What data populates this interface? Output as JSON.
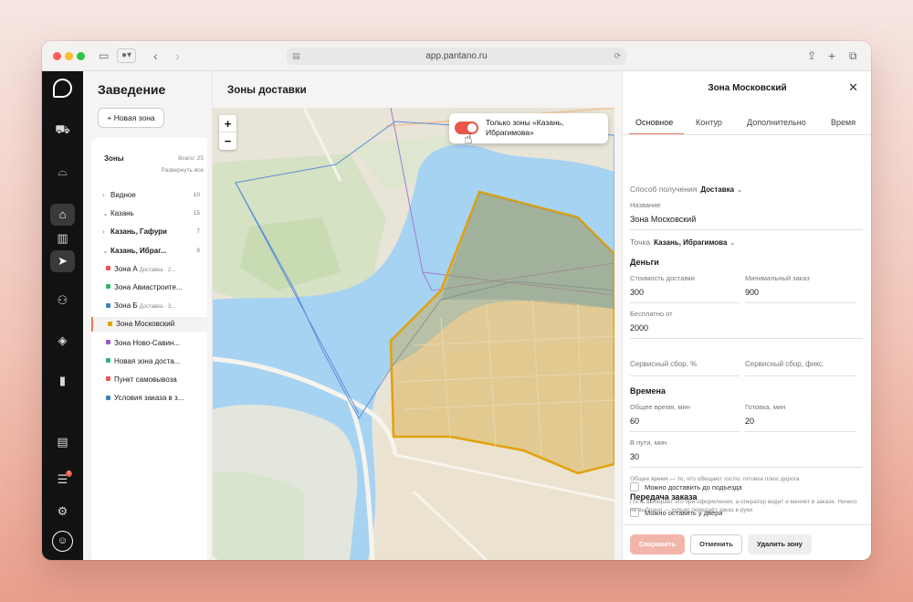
{
  "browser": {
    "url": "app.pantano.ru"
  },
  "rail": {
    "notifications_badge": "1"
  },
  "sidebar": {
    "title": "Заведение",
    "new_zone_button": "Новая зона",
    "zones_label": "Зоны",
    "zones_total": "Всего: 25",
    "expand_all": "Развернуть все",
    "tree": [
      {
        "label": "Видное",
        "count": "10",
        "level": 0,
        "chev": "›"
      },
      {
        "label": "Казань",
        "count": "15",
        "level": 0,
        "chev": "⌄"
      },
      {
        "label": "Казань, Гафури",
        "count": "7",
        "level": 1,
        "chev": "›",
        "bold": true
      },
      {
        "label": "Казань, Ибраг...",
        "count": "8",
        "level": 1,
        "chev": "⌄",
        "bold": true
      },
      {
        "label": "Зона А",
        "sub": "Доставка · 2...",
        "color": "#e8584a",
        "level": 2
      },
      {
        "label": "Зона Авиастроите...",
        "color": "#2bb673",
        "level": 2
      },
      {
        "label": "Зона Б",
        "sub": "Доставка · 3...",
        "color": "#3b82c4",
        "level": 2
      },
      {
        "label": "Зона Московский",
        "color": "#e0a400",
        "level": 2,
        "selected": true
      },
      {
        "label": "Зона Ново-Савин...",
        "color": "#9b59d0",
        "level": 2
      },
      {
        "label": "Новая зона доста...",
        "color": "#2bb673",
        "level": 2
      },
      {
        "label": "Пункт самовывоза",
        "color": "#e8584a",
        "level": 2
      },
      {
        "label": "Условия заказа в з...",
        "color": "#3b82c4",
        "level": 2
      }
    ]
  },
  "map": {
    "title": "Зоны доставки",
    "zoom_in": "+",
    "zoom_out": "−",
    "toggle_label": "Только зоны «Казань, Ибрагимова»",
    "toggle_on": true
  },
  "details": {
    "title": "Зона Московский",
    "tabs": [
      "Основное",
      "Контур",
      "Дополнительно",
      "Время"
    ],
    "receive_method_label": "Способ получения",
    "receive_method_value": "Доставка",
    "name_label": "Название",
    "name_value": "Зона Московский",
    "point_label": "Точка",
    "point_value": "Казань, Ибрагимова",
    "money_section": "Деньги",
    "delivery_cost_label": "Стоимость доставки",
    "delivery_cost_value": "300",
    "min_order_label": "Минимальный заказ",
    "min_order_value": "900",
    "free_from_label": "Бесплатно от",
    "free_from_value": "2000",
    "service_fee_pct_label": "Сервисный сбор, %",
    "service_fee_fixed_label": "Сервисный сбор, фикс.",
    "times_section": "Времена",
    "total_time_label": "Общее время, мин",
    "total_time_value": "60",
    "ready_label": "Готовка, мин",
    "ready_value": "20",
    "transit_label": "В пути, мин",
    "transit_value": "30",
    "time_hint": "Общее время — то, что обещают гостю: готовка плюс дорога",
    "handover_section": "Передача заказа",
    "leave_at_door": "Можно оставить у двери",
    "deliver_to_entrance": "Можно доставить до подъезда",
    "handover_hint": "Гость выбирает это при оформлении, а оператор видит и меняет в заказе. Ничего не выбрано — курьер передаёт заказ в руки",
    "save_button": "Сохранить",
    "cancel_button": "Отменить",
    "delete_button": "Удалить зону"
  }
}
